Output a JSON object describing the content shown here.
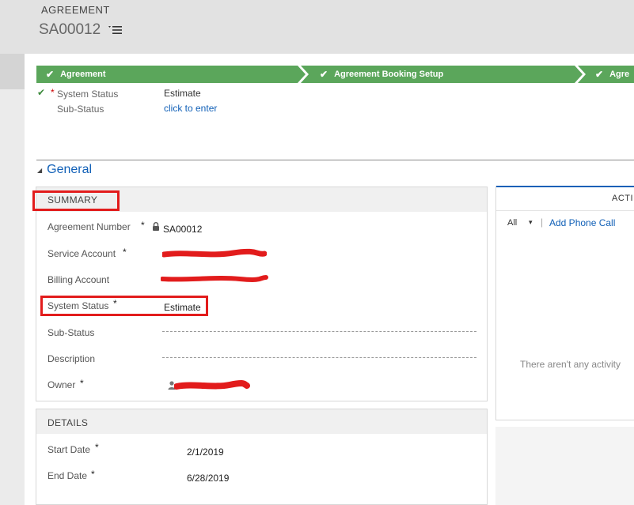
{
  "header": {
    "entity_label": "AGREEMENT",
    "record_name": "SA00012"
  },
  "bpf": {
    "stages": [
      {
        "label": "Agreement"
      },
      {
        "label": "Agreement Booking Setup"
      },
      {
        "label": "Agre"
      }
    ],
    "fields": {
      "system_status_label": "System Status",
      "system_status_value": "Estimate",
      "sub_status_label": "Sub-Status",
      "sub_status_value": "click to enter"
    }
  },
  "general": {
    "title": "General"
  },
  "summary": {
    "title": "SUMMARY",
    "fields": {
      "agreement_number_label": "Agreement Number",
      "agreement_number_value": "SA00012",
      "service_account_label": "Service Account",
      "billing_account_label": "Billing Account",
      "system_status_label": "System Status",
      "system_status_value": "Estimate",
      "sub_status_label": "Sub-Status",
      "description_label": "Description",
      "owner_label": "Owner"
    }
  },
  "details": {
    "title": "DETAILS",
    "fields": {
      "start_date_label": "Start Date",
      "start_date_value": "2/1/2019",
      "end_date_label": "End Date",
      "end_date_value": "6/28/2019"
    }
  },
  "activities": {
    "title": "ACTI",
    "filter_value": "All",
    "add_phone_call": "Add Phone Call",
    "empty_text": "There aren't any activity"
  },
  "required_marker": "*",
  "colors": {
    "bpf_green": "#5ba65b",
    "link_blue": "#1160b7",
    "annotation_red": "#e21c1c"
  }
}
